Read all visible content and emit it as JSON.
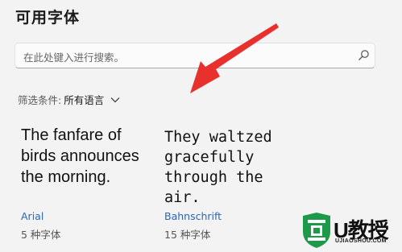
{
  "page": {
    "title": "可用字体"
  },
  "search": {
    "placeholder": "在此处键入进行搜索。"
  },
  "filter": {
    "label": "筛选条件:",
    "value": "所有语言"
  },
  "fonts": [
    {
      "preview": "The fanfare of birds announces the morning.",
      "name": "Arial",
      "count": "5 种字体"
    },
    {
      "preview": "They waltzed gracefully through the air.",
      "name": "Bahnschrift",
      "count": "15 种字体"
    }
  ],
  "colors": {
    "accent": "#2b66b8",
    "arrow": "#e8312c",
    "background": "#f3f3f3"
  },
  "watermark": {
    "brand": "U教授",
    "url": "UJIAOSHOU.COM"
  }
}
